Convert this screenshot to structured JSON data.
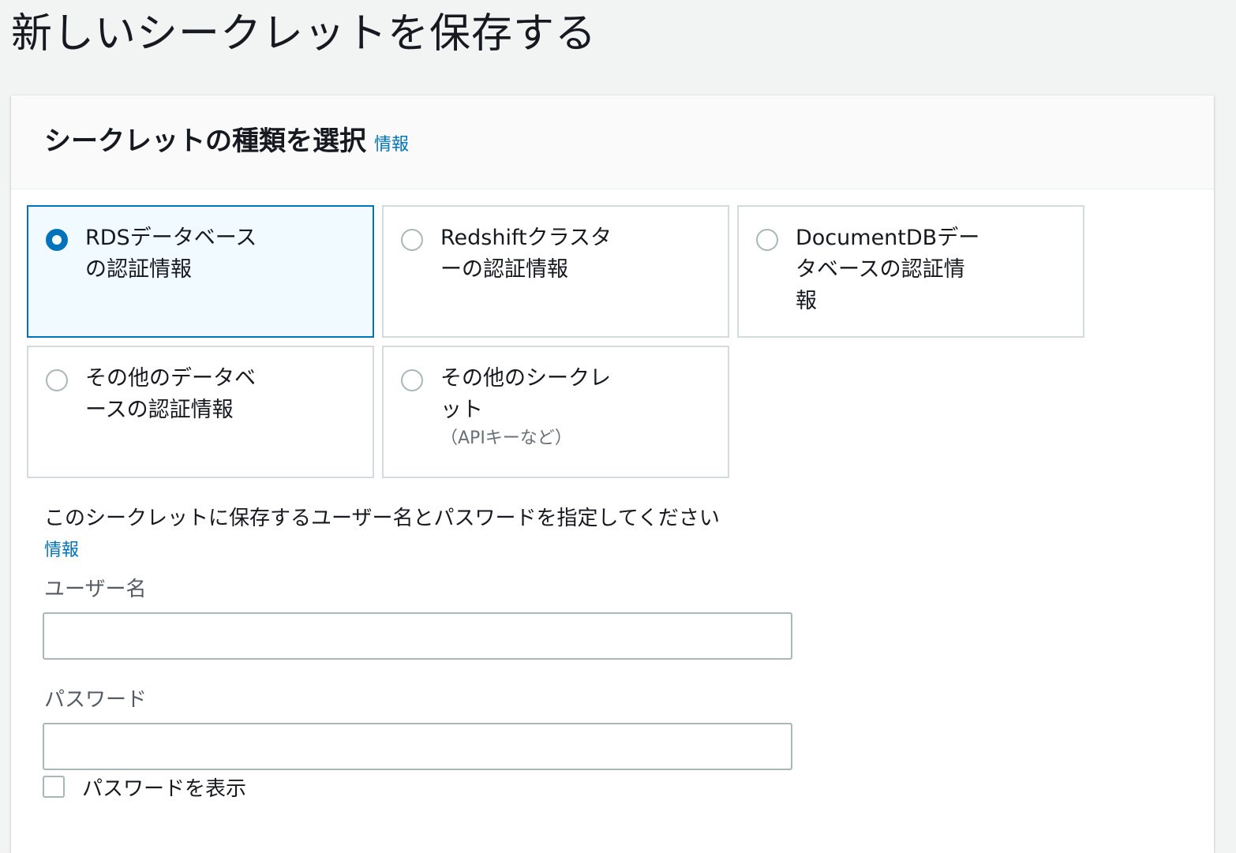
{
  "page": {
    "title": "新しいシークレットを保存する"
  },
  "secret_type": {
    "heading": "シークレットの種類を選択",
    "info_link": "情報",
    "selected": "rds",
    "options": [
      {
        "id": "rds",
        "label": "RDSデータベースの認証情報",
        "sublabel": "",
        "checked": true
      },
      {
        "id": "redshift",
        "label": "Redshiftクラスターの認証情報",
        "sublabel": "",
        "checked": false
      },
      {
        "id": "documentdb",
        "label": "DocumentDBデータベースの認証情報",
        "sublabel": "",
        "checked": false
      },
      {
        "id": "other-db",
        "label": "その他のデータベースの認証情報",
        "sublabel": "",
        "checked": false
      },
      {
        "id": "other",
        "label": "その他のシークレット",
        "sublabel": "（APIキーなど）",
        "checked": false
      }
    ]
  },
  "credentials": {
    "description": "このシークレットに保存するユーザー名とパスワードを指定してください",
    "info_link": "情報",
    "username_label": "ユーザー名",
    "username_value": "",
    "password_label": "パスワード",
    "password_value": "",
    "show_password_label": "パスワードを表示",
    "show_password_checked": false
  },
  "colors": {
    "accent": "#0073bb",
    "selected_tile_bg": "#f1faff",
    "page_bg": "#f2f3f3",
    "border": "#d5dbdb"
  }
}
